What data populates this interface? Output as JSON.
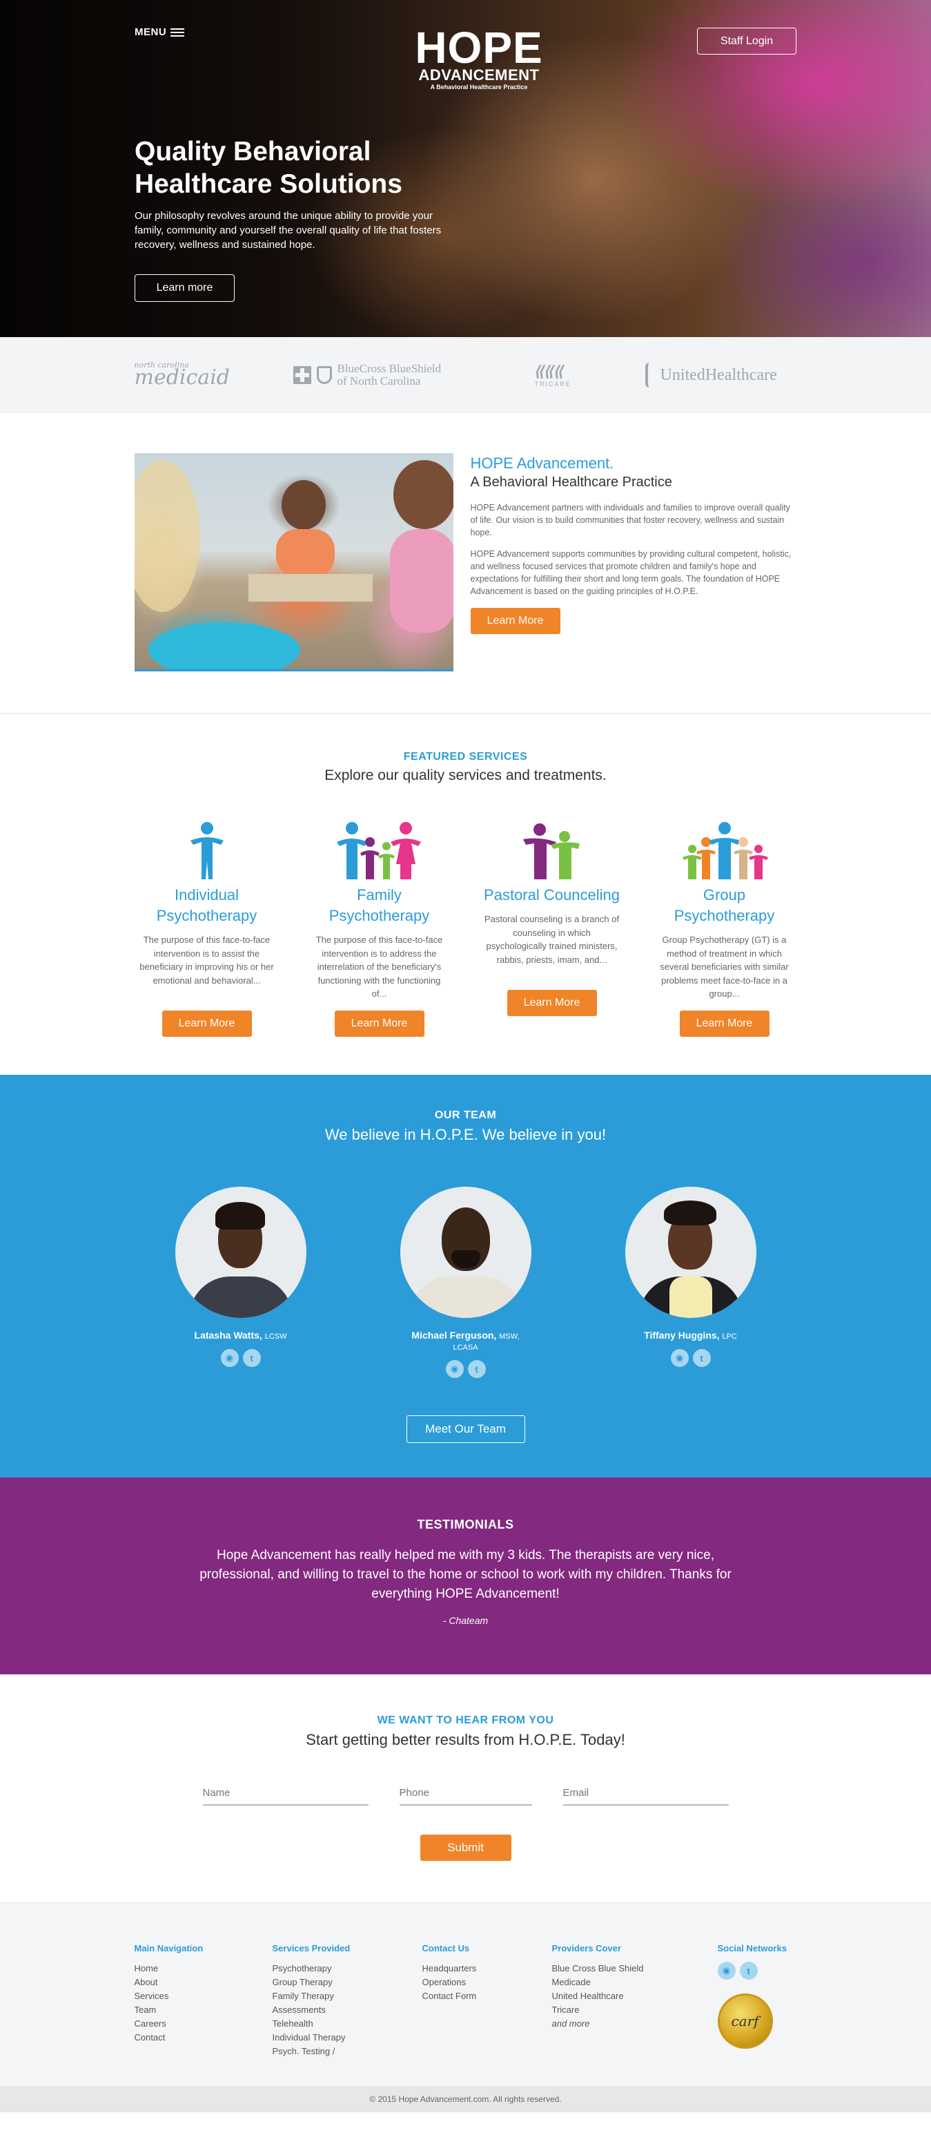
{
  "header": {
    "menu_label": "MENU",
    "logo_hope": "HOPE",
    "logo_advancement": "ADVANCEMENT",
    "logo_tagline": "A Behavioral Healthcare Practice",
    "staff_login": "Staff Login"
  },
  "hero": {
    "title": "Quality Behavioral Healthcare Solutions",
    "text": "Our philosophy revolves around the unique ability to provide your family, community and yourself the overall quality of life that fosters recovery, wellness and sustained hope.",
    "button": "Learn more"
  },
  "partners": {
    "medicaid_small": "north carolina",
    "medicaid": "medicaid",
    "bcbs_line1": "BlueCross BlueShield",
    "bcbs_line2": "of North Carolina",
    "tricare": "TRICARE",
    "uhc": "UnitedHealthcare"
  },
  "about": {
    "title": "HOPE Advancement.",
    "subtitle": "A Behavioral Healthcare Practice",
    "p1": "HOPE Advancement partners with individuals and families to improve overall quality of life. Our vision is to build communities that foster recovery, wellness and sustain hope.",
    "p2": "HOPE Advancement supports communities by providing cultural competent, holistic, and wellness focused services that promote children and family's hope and expectations for fulfilling their short and long term goals. The foundation of HOPE Advancement is based on the guiding principles of H.O.P.E.",
    "button": "Learn More"
  },
  "services": {
    "label": "FEATURED SERVICES",
    "subtitle": "Explore our quality services and treatments.",
    "items": [
      {
        "name": "Individual Psychotherapy",
        "desc": "The purpose of this face-to-face intervention is to assist the beneficiary in improving his or her emotional and behavioral...",
        "button": "Learn More"
      },
      {
        "name": "Family Psychotherapy",
        "desc": "The purpose of this face-to-face intervention is to address the interrelation of the beneficiary's functioning with the functioning of...",
        "button": "Learn More"
      },
      {
        "name": "Pastoral Counceling",
        "desc": "Pastoral counseling is a branch of counseling in which psychologically trained ministers, rabbis, priests, imam, and...",
        "button": "Learn More"
      },
      {
        "name": "Group Psychotherapy",
        "desc": "Group Psychotherapy (GT) is a method of treatment in which several beneficiaries with similar problems meet face-to-face in a group...",
        "button": "Learn More"
      }
    ]
  },
  "team": {
    "label": "OUR TEAM",
    "subtitle": "We believe in H.O.P.E. We believe in you!",
    "members": [
      {
        "name": "Latasha Watts,",
        "cred": "LCSW"
      },
      {
        "name": "Michael Ferguson,",
        "cred": "MSW, LCASA"
      },
      {
        "name": "Tiffany Huggins,",
        "cred": "LPC"
      }
    ],
    "button": "Meet Our Team"
  },
  "testimonials": {
    "label": "TESTIMONIALS",
    "quote": "Hope Advancement has really helped me with my 3 kids. The therapists are very nice, professional, and willing to travel to the home or school to work with my children. Thanks for everything HOPE Advancement!",
    "author": "- Chateam"
  },
  "contact": {
    "label": "WE WANT TO HEAR FROM YOU",
    "subtitle": "Start getting better results from H.O.P.E. Today!",
    "name_placeholder": "Name",
    "phone_placeholder": "Phone",
    "email_placeholder": "Email",
    "submit": "Submit"
  },
  "footer": {
    "main_nav": {
      "title": "Main Navigation",
      "links": [
        "Home",
        "About",
        "Services",
        "Team",
        "Careers",
        "Contact"
      ]
    },
    "services": {
      "title": "Services Provided",
      "links": [
        "Psychotherapy",
        "Group Therapy",
        "Family Therapy",
        "Assessments",
        "Telehealth",
        "Individual Therapy",
        "Psych. Testing /"
      ]
    },
    "contact": {
      "title": "Contact Us",
      "links": [
        "Headquarters",
        "Operations",
        "Contact Form"
      ]
    },
    "providers": {
      "title": "Providers Cover",
      "links": [
        "Blue Cross Blue Shield",
        "Medicade",
        "United Healthcare",
        "Tricare"
      ],
      "more": "and more"
    },
    "social": {
      "title": "Social Networks",
      "carf": "carf"
    },
    "copyright": "© 2015 Hope Advancement.com. All rights reserved."
  },
  "colors": {
    "brand_blue": "#2b9cd8",
    "brand_orange": "#f08428",
    "brand_purple": "#83297f"
  }
}
